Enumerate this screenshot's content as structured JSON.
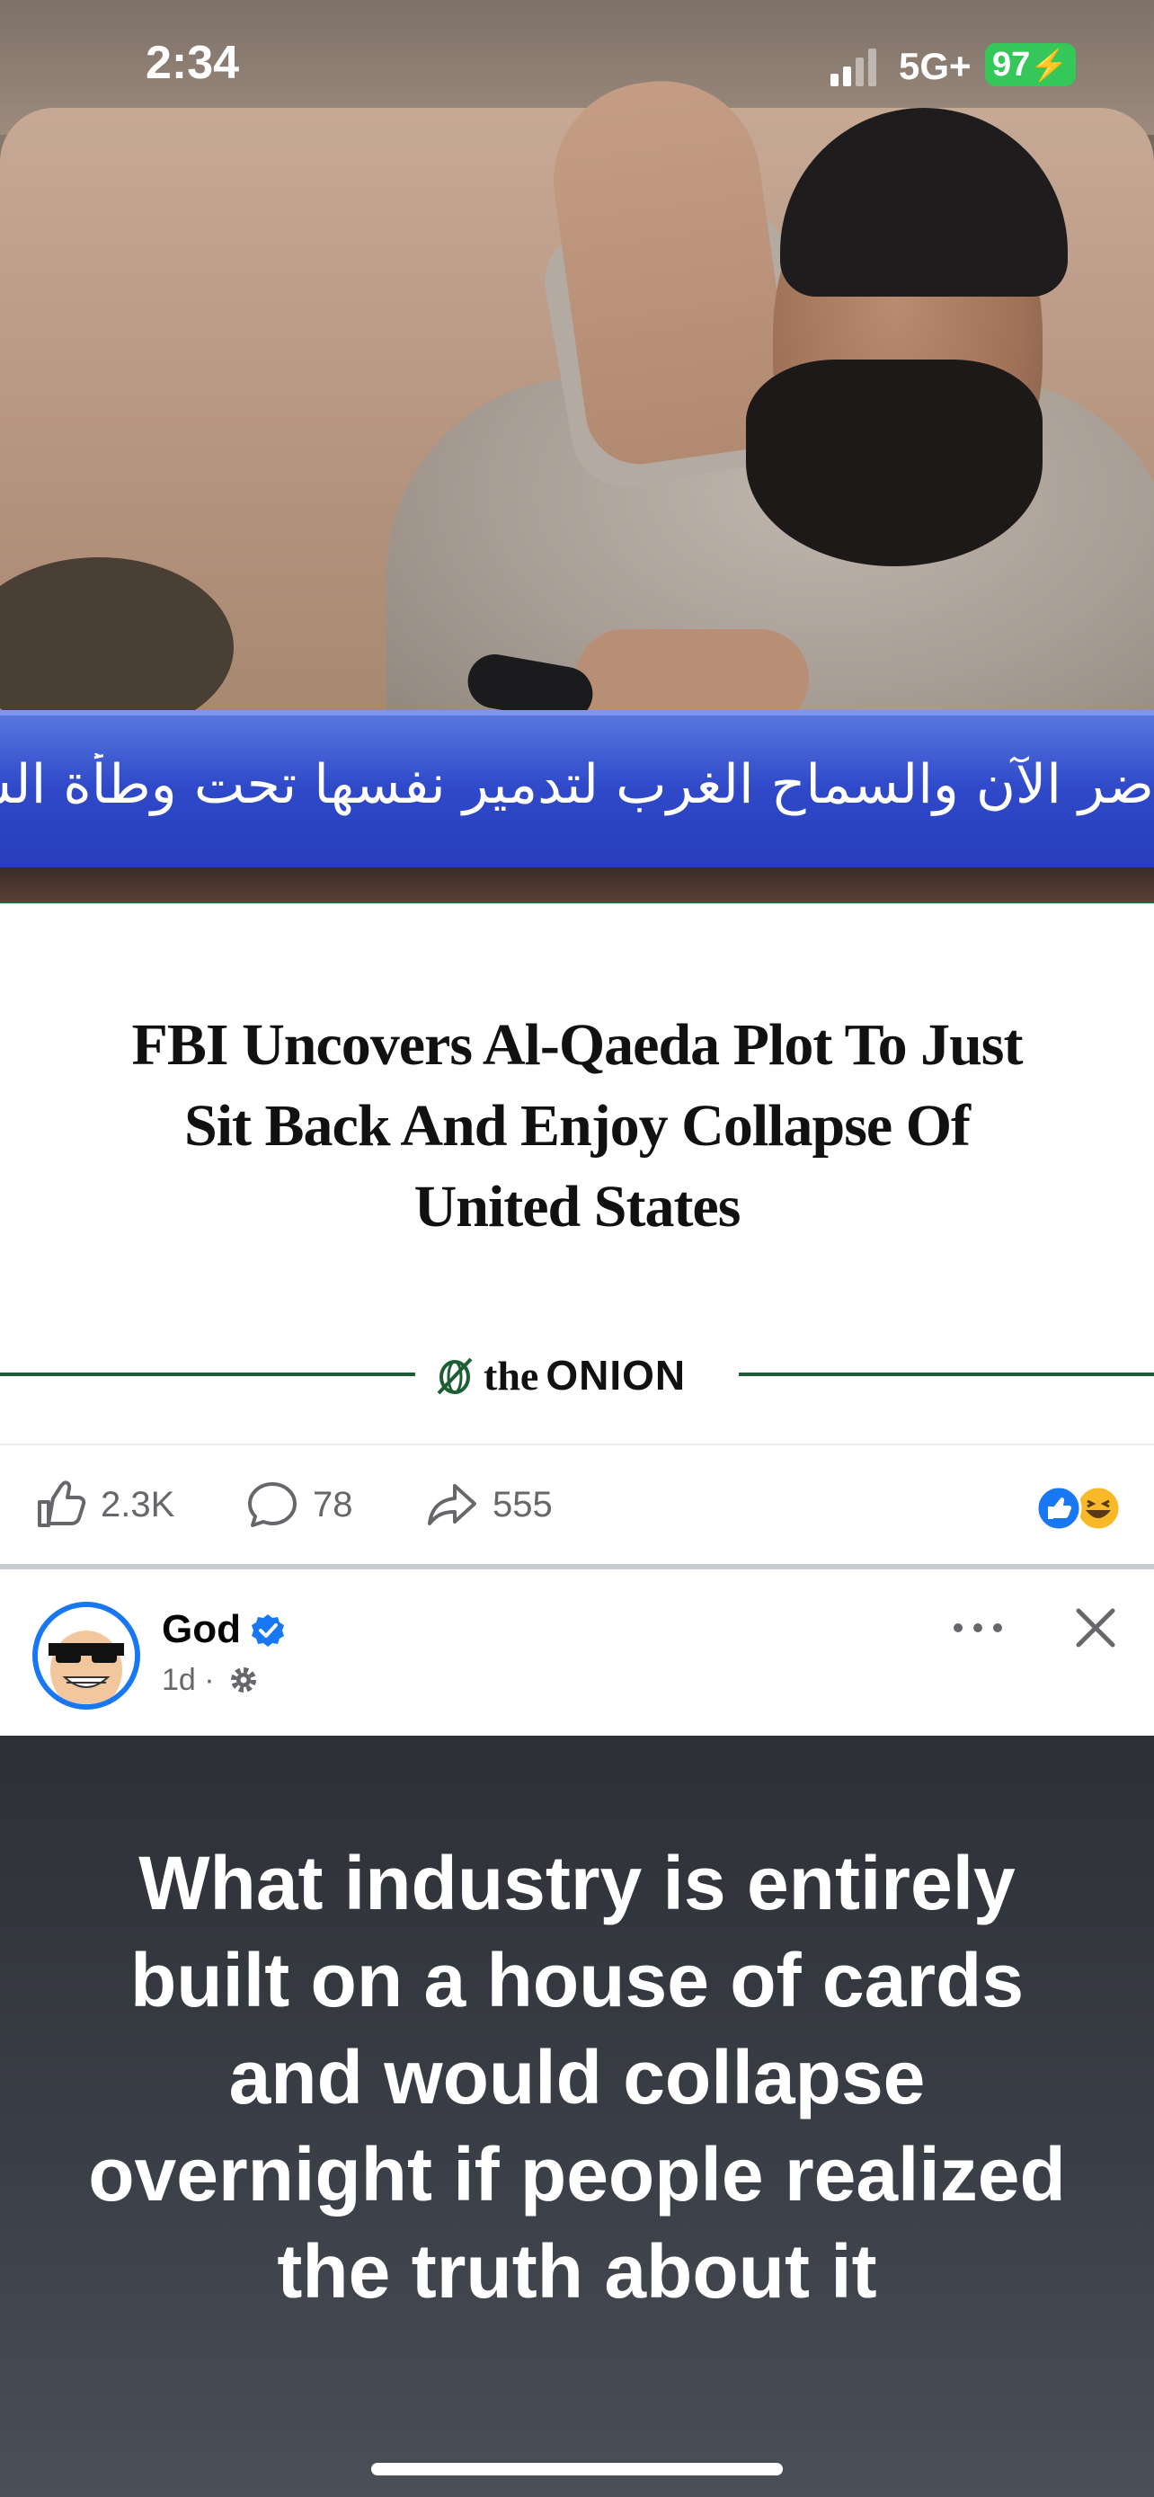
{
  "status_bar": {
    "time": "2:34",
    "network": "5G+",
    "battery": "97"
  },
  "news_image": {
    "ticker_text": "ضر الآن والسماح الغرب لتدمير نفسها تحت وطأة الشارة الخاصة."
  },
  "link_card": {
    "headline": "FBI Uncovers Al-Qaeda Plot To Just Sit Back And Enjoy Collapse Of United States",
    "publisher_the": "the",
    "publisher_name": "ONION",
    "brand_color": "#1d5e34"
  },
  "actions": {
    "likes": "2.3K",
    "comments": "78",
    "shares": "555"
  },
  "next_post": {
    "author": "God",
    "time": "1d ·",
    "text": "What industry is entirely built on a house of cards and would collapse overnight if people realized the truth about it"
  },
  "colors": {
    "facebook_blue": "#1877f2",
    "battery_green": "#35c759"
  }
}
